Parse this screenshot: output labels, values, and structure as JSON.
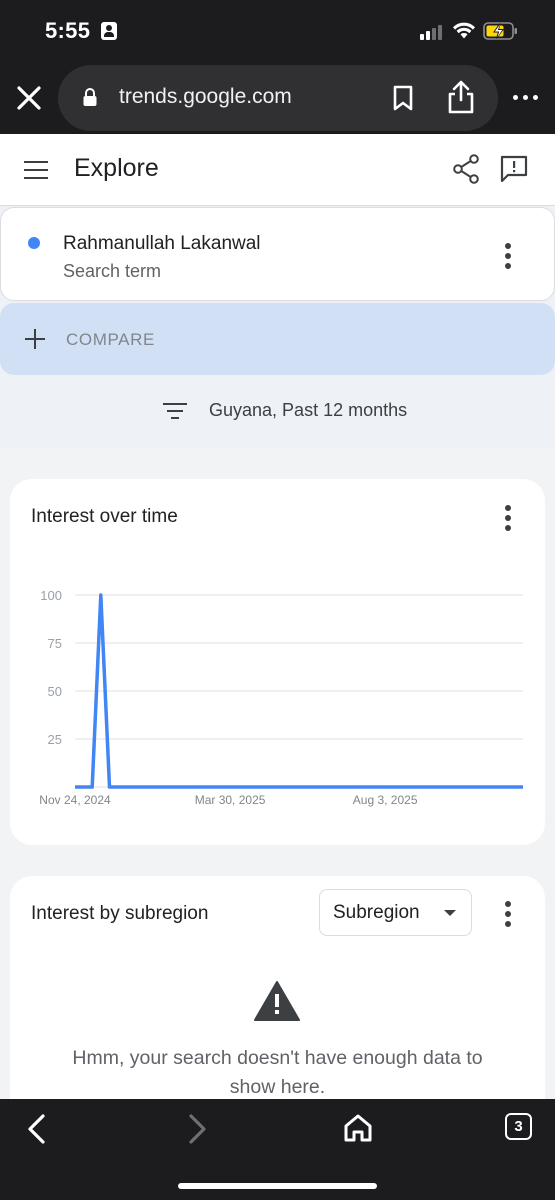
{
  "status_bar": {
    "time": "5:55",
    "icons": [
      "person-badge-icon",
      "cellular-signal-icon",
      "wifi-icon",
      "battery-charging-icon"
    ],
    "battery_color": "#ffd60a"
  },
  "browser": {
    "url": "trends.google.com",
    "icons": [
      "close-icon",
      "lock-icon",
      "bookmark-icon",
      "share-icon",
      "more-horizontal-icon",
      "back-icon",
      "forward-icon",
      "home-icon"
    ],
    "tab_count": "3"
  },
  "header": {
    "title": "Explore",
    "icons": [
      "menu-icon",
      "share-icon",
      "feedback-icon"
    ]
  },
  "search_term": {
    "name": "Rahmanullah Lakanwal",
    "subtitle": "Search term",
    "color": "#4285f4"
  },
  "compare": {
    "label": "COMPARE",
    "background": "#d2e0f6"
  },
  "filter": {
    "text": "Guyana, Past 12 months"
  },
  "interest_over_time": {
    "title": "Interest over time"
  },
  "chart_data": {
    "type": "line",
    "title": "Interest over time",
    "xlabel": "",
    "ylabel": "",
    "y_ticks": [
      100,
      75,
      50,
      25
    ],
    "ylim": [
      0,
      100
    ],
    "x_tick_labels": [
      "Nov 24, 2024",
      "Mar 30, 2025",
      "Aug 3, 2025"
    ],
    "grid": true,
    "series": [
      {
        "color": "#4285f4",
        "x": [
          "Nov 24, 2024",
          "Dec 1, 2024",
          "Dec 8, 2024",
          "Dec 15, 2024",
          "Dec 22, 2024",
          "Dec 29, 2024",
          "Nov 23, 2025"
        ],
        "values": [
          0,
          0,
          0,
          100,
          0,
          0,
          0
        ]
      }
    ]
  },
  "subregion": {
    "title": "Interest by subregion",
    "select_value": "Subregion",
    "message": "Hmm, your search doesn't have enough data to show here."
  }
}
